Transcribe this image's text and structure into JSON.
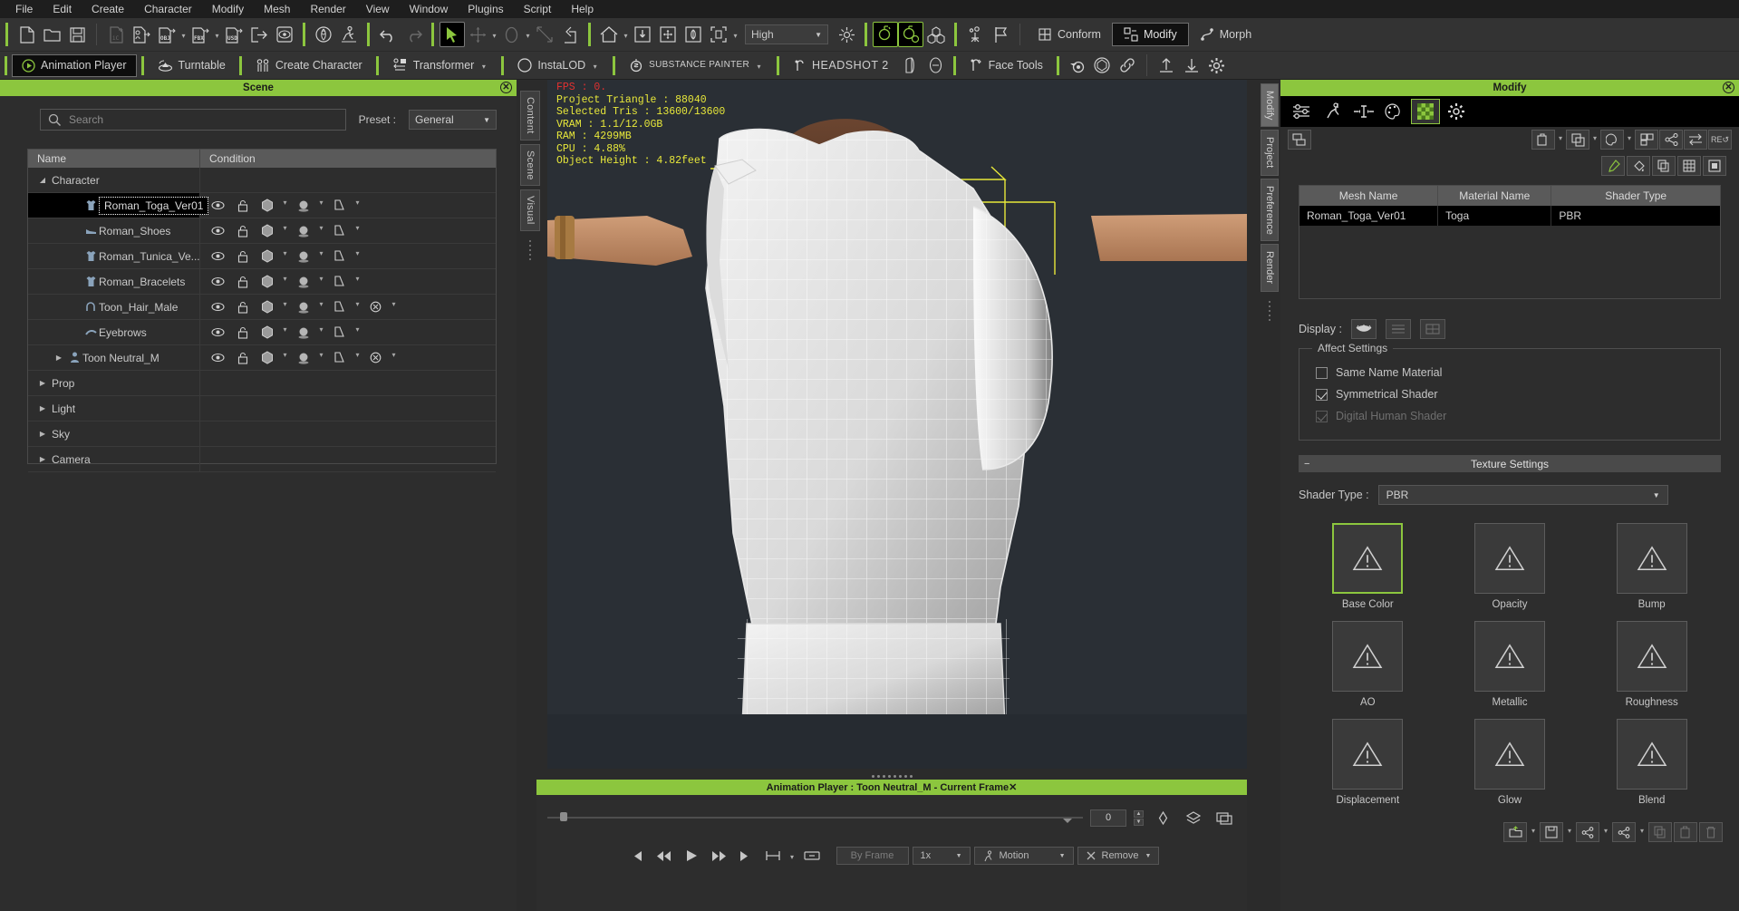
{
  "menu": {
    "items": [
      "File",
      "Edit",
      "Create",
      "Character",
      "Modify",
      "Mesh",
      "Render",
      "View",
      "Window",
      "Plugins",
      "Script",
      "Help"
    ]
  },
  "toolbar": {
    "quality_label": "High",
    "icons": [
      "new-file-icon",
      "open-folder-icon",
      "save-icon",
      "import-ic-icon",
      "import-character-icon",
      "import-obj-icon",
      "import-fbx-icon",
      "import-usd-icon",
      "export-icon",
      "preview-icon",
      "3d-scan-icon",
      "motion-icon",
      "undo-icon",
      "redo-icon",
      "select-tool-icon",
      "move-tool-icon",
      "rotate-tool-icon",
      "scale-tool-icon",
      "align-icon",
      "home-view-icon",
      "fit-view-icon",
      "pan-view-icon",
      "orbit-view-icon",
      "frame-selected-icon",
      "light-icon",
      "render-preview-icon",
      "render-icon",
      "lod-icon",
      "camera-set-icon",
      "flag-icon"
    ]
  },
  "plugin_tabs": [
    {
      "label": "Animation Player",
      "icon": "play-circle-icon",
      "active": true,
      "caret": false
    },
    {
      "label": "Turntable",
      "icon": "turntable-icon",
      "active": false,
      "caret": false
    },
    {
      "label": "Create Character",
      "icon": "create-character-icon",
      "active": false,
      "caret": false
    },
    {
      "label": "Transformer",
      "icon": "transformer-icon",
      "active": false,
      "caret": true
    },
    {
      "label": "InstaLOD",
      "icon": "instalod-icon",
      "active": false,
      "caret": true
    },
    {
      "label": "SUBSTANCE PAINTER",
      "icon": "substance-painter-icon",
      "active": false,
      "caret": true
    },
    {
      "label": "HEADSHOT 2",
      "icon": "headshot-icon",
      "active": false,
      "caret": false
    },
    {
      "label": "Face Tools",
      "icon": "face-tools-icon",
      "active": false,
      "caret": false
    }
  ],
  "plugin_extra_icons": [
    "headshot-sculpt-icon",
    "headshot-head-icon",
    "blender-icon",
    "unreal-icon",
    "link-icon",
    "upload-icon",
    "download-icon",
    "settings-gear-icon"
  ],
  "right_toolbar": {
    "conform_label": "Conform",
    "modify_label": "Modify",
    "morph_label": "Morph"
  },
  "scene_panel": {
    "title": "Scene",
    "search_placeholder": "Search",
    "search_value": "",
    "preset_label": "Preset :",
    "preset_value": "General",
    "columns": [
      "Name",
      "Condition"
    ],
    "rows": [
      {
        "label": "Character",
        "depth": 0,
        "twisty": "down",
        "icon": "",
        "selected": false,
        "editing": false,
        "has_condition": false,
        "extra_icon": false
      },
      {
        "label": "Roman_Toga_Ver01",
        "depth": 2,
        "twisty": "",
        "icon": "cloth-icon",
        "selected": true,
        "editing": true,
        "has_condition": true,
        "extra_icon": false
      },
      {
        "label": "Roman_Shoes",
        "depth": 2,
        "twisty": "",
        "icon": "shoe-icon",
        "selected": false,
        "editing": false,
        "has_condition": true,
        "extra_icon": false
      },
      {
        "label": "Roman_Tunica_Ve...",
        "depth": 2,
        "twisty": "",
        "icon": "cloth-icon",
        "selected": false,
        "editing": false,
        "has_condition": true,
        "extra_icon": false
      },
      {
        "label": "Roman_Bracelets",
        "depth": 2,
        "twisty": "",
        "icon": "cloth-icon",
        "selected": false,
        "editing": false,
        "has_condition": true,
        "extra_icon": false
      },
      {
        "label": "Toon_Hair_Male",
        "depth": 2,
        "twisty": "",
        "icon": "hair-icon",
        "selected": false,
        "editing": false,
        "has_condition": true,
        "extra_icon": true
      },
      {
        "label": "Eyebrows",
        "depth": 2,
        "twisty": "",
        "icon": "eyebrow-icon",
        "selected": false,
        "editing": false,
        "has_condition": true,
        "extra_icon": false
      },
      {
        "label": "Toon Neutral_M",
        "depth": 1,
        "twisty": "right",
        "icon": "person-icon",
        "selected": false,
        "editing": false,
        "has_condition": true,
        "extra_icon": true
      },
      {
        "label": "Prop",
        "depth": 0,
        "twisty": "right",
        "icon": "",
        "selected": false,
        "editing": false,
        "has_condition": false,
        "extra_icon": false
      },
      {
        "label": "Light",
        "depth": 0,
        "twisty": "right",
        "icon": "",
        "selected": false,
        "editing": false,
        "has_condition": false,
        "extra_icon": false
      },
      {
        "label": "Sky",
        "depth": 0,
        "twisty": "right",
        "icon": "",
        "selected": false,
        "editing": false,
        "has_condition": false,
        "extra_icon": false
      },
      {
        "label": "Camera",
        "depth": 0,
        "twisty": "right",
        "icon": "",
        "selected": false,
        "editing": false,
        "has_condition": false,
        "extra_icon": false
      }
    ]
  },
  "dock_tabs_left": [
    "Content",
    "Scene",
    "Visual"
  ],
  "dock_tabs_right": [
    "Modify",
    "Project",
    "Preference",
    "Render"
  ],
  "viewport": {
    "stats": {
      "fps": "FPS : 0.",
      "project_triangle": "Project Triangle : 88040",
      "selected_tris": "Selected Tris : 13600/13600",
      "vram": "VRAM : 1.1/12.0GB",
      "ram": "RAM : 4299MB",
      "cpu": "CPU : 4.88%",
      "object_height": "Object Height : 4.82feet"
    }
  },
  "anim_player": {
    "title": "Animation Player : Toon Neutral_M - Current Frame",
    "frame_value": "0",
    "by_frame_label": "By Frame",
    "speed_label": "1x",
    "motion_label": "Motion",
    "remove_label": "Remove",
    "transport_icons": [
      "skip-start-icon",
      "step-back-icon",
      "play-icon",
      "step-forward-icon",
      "skip-end-icon",
      "range-icon",
      "loop-icon"
    ],
    "right_icons": [
      "keyframe-icon",
      "layers-icon",
      "screen-icon"
    ]
  },
  "modify_panel": {
    "title": "Modify",
    "toolbar_icons": [
      "sliders-icon",
      "pose-icon",
      "align-center-icon",
      "palette-icon",
      "checker-material-icon",
      "settings-gear-icon"
    ],
    "toolbar2_icons": [
      "copy-panel-icon",
      "paste-panel-icon",
      "duplicate-icon",
      "palette2-icon",
      "layers2-icon",
      "share-icon",
      "swap-icon",
      "reset-icon"
    ],
    "toolbar3_icons": [
      "eyedropper-icon",
      "paint-bucket-icon",
      "copy-icon",
      "grid-icon",
      "fit-icon"
    ],
    "table": {
      "columns": [
        "Mesh Name",
        "Material Name",
        "Shader Type"
      ],
      "rows": [
        {
          "mesh": "Roman_Toga_Ver01",
          "material": "Toga",
          "shader": "PBR"
        }
      ]
    },
    "display_label": "Display :",
    "display_buttons": [
      "eyelash-display-icon",
      "flat-display-icon",
      "wire-display-icon"
    ],
    "affect_settings": {
      "title": "Affect Settings",
      "options": [
        {
          "label": "Same Name Material",
          "checked": false,
          "disabled": false
        },
        {
          "label": "Symmetrical Shader",
          "checked": true,
          "disabled": false
        },
        {
          "label": "Digital Human Shader",
          "checked": true,
          "disabled": true
        }
      ]
    },
    "texture_settings": {
      "title": "Texture Settings",
      "shader_type_label": "Shader Type :",
      "shader_type_value": "PBR",
      "slots": [
        {
          "label": "Base Color",
          "selected": true
        },
        {
          "label": "Opacity",
          "selected": false
        },
        {
          "label": "Bump",
          "selected": false
        },
        {
          "label": "AO",
          "selected": false
        },
        {
          "label": "Metallic",
          "selected": false
        },
        {
          "label": "Roughness",
          "selected": false
        },
        {
          "label": "Displacement",
          "selected": false
        },
        {
          "label": "Glow",
          "selected": false
        },
        {
          "label": "Blend",
          "selected": false
        }
      ]
    },
    "bottom_icons": [
      "load-texture-icon",
      "save-texture-icon",
      "share-texture-icon",
      "share2-icon",
      "copy-texture-icon",
      "paste-texture-icon",
      "delete-texture-icon"
    ]
  },
  "colors": {
    "accent_green": "#8cc63e",
    "panel_bg": "#2d2d2d",
    "toolbar_bg": "#333333",
    "menu_bg": "#1e1e1e",
    "viewport_bg": "#2a2f35",
    "stat_yellow": "#e8e83a",
    "stat_red": "#e03030"
  }
}
